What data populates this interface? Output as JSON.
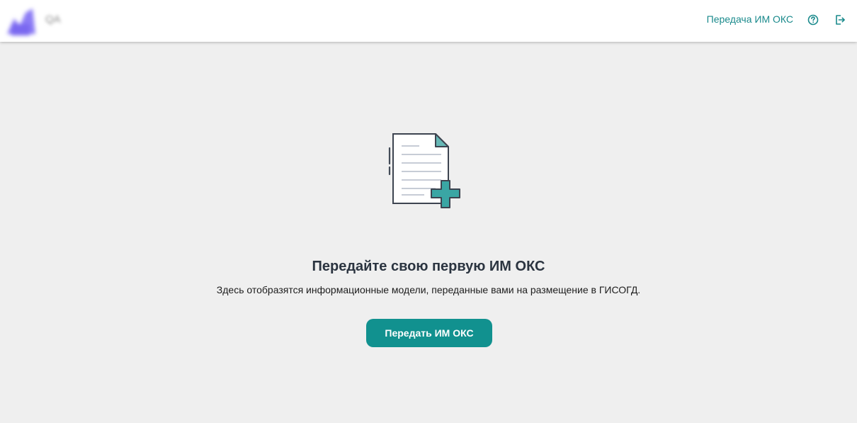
{
  "header": {
    "logo_text": "QA",
    "nav_link": "Передача ИМ ОКС",
    "icons": [
      "help-circle-icon",
      "logout-icon"
    ]
  },
  "empty_state": {
    "illustration": "document-add-icon",
    "title": "Передайте свою первую ИМ ОКС",
    "description": "Здесь отобразятся информационные модели, переданные вами на размещение в ГИСОГД.",
    "button_label": "Передать ИМ ОКС"
  },
  "colors": {
    "accent": "#11918f",
    "link": "#1a8a8c",
    "background": "#efefef",
    "header_bg": "#ffffff",
    "title": "#2b3440"
  }
}
